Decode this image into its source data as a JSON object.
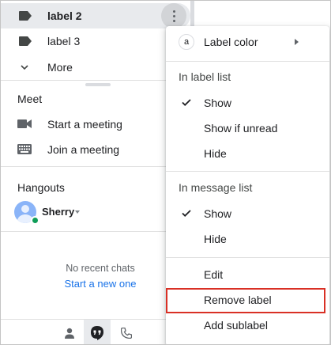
{
  "sidebar": {
    "labels": [
      {
        "label": "label 2"
      },
      {
        "label": "label 3"
      }
    ],
    "more_label": "More",
    "meet": {
      "title": "Meet",
      "start_label": "Start a meeting",
      "join_label": "Join a meeting"
    },
    "hangouts": {
      "title": "Hangouts",
      "user_name": "Sherry",
      "no_chats_text": "No recent chats",
      "start_new_link": "Start a new one"
    },
    "bottom_bar": {
      "icons": [
        "contacts-icon",
        "hangouts-icon",
        "phone-icon"
      ],
      "active_index": 1
    }
  },
  "context_menu": {
    "label_color": {
      "glyph": "a",
      "label": "Label color"
    },
    "in_label_list": {
      "heading": "In label list",
      "options": [
        {
          "label": "Show",
          "checked": true
        },
        {
          "label": "Show if unread",
          "checked": false
        },
        {
          "label": "Hide",
          "checked": false
        }
      ]
    },
    "in_message_list": {
      "heading": "In message list",
      "options": [
        {
          "label": "Show",
          "checked": true
        },
        {
          "label": "Hide",
          "checked": false
        }
      ]
    },
    "actions": [
      {
        "label": "Edit"
      },
      {
        "label": "Remove label",
        "highlighted": true
      },
      {
        "label": "Add sublabel"
      }
    ]
  },
  "colors": {
    "highlight_border": "#d93025",
    "link": "#1a73e8",
    "presence": "#0f9d58"
  }
}
